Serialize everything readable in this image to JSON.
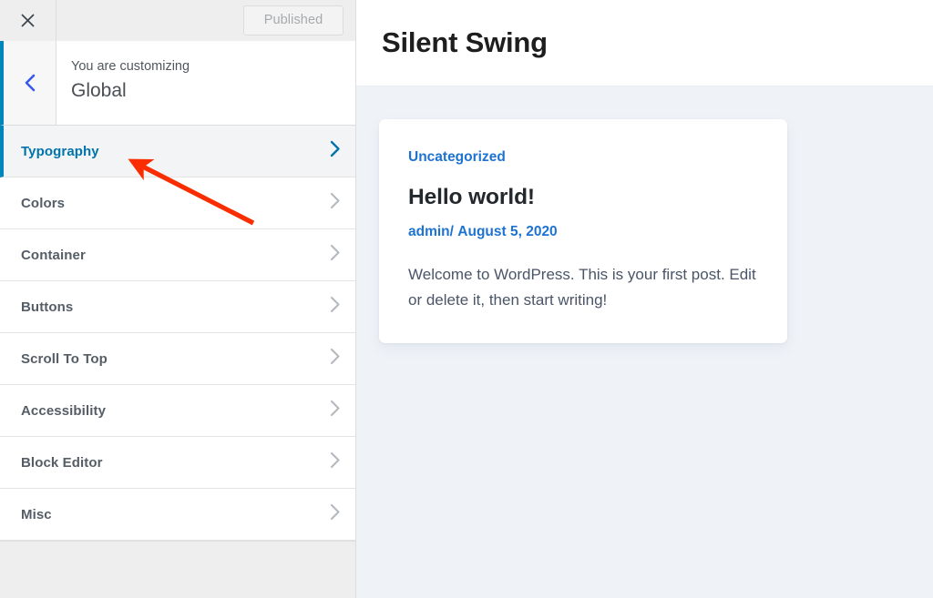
{
  "customizer": {
    "topbar": {
      "close_icon": "close-x-icon",
      "publish_label": "Published"
    },
    "panel": {
      "back_icon": "chevron-left-icon",
      "customizing_label": "You are customizing",
      "title": "Global"
    },
    "sections": [
      {
        "label": "Typography",
        "icon": "chevron-right-icon",
        "active": true
      },
      {
        "label": "Colors",
        "icon": "chevron-right-icon",
        "active": false
      },
      {
        "label": "Container",
        "icon": "chevron-right-icon",
        "active": false
      },
      {
        "label": "Buttons",
        "icon": "chevron-right-icon",
        "active": false
      },
      {
        "label": "Scroll To Top",
        "icon": "chevron-right-icon",
        "active": false
      },
      {
        "label": "Accessibility",
        "icon": "chevron-right-icon",
        "active": false
      },
      {
        "label": "Block Editor",
        "icon": "chevron-right-icon",
        "active": false
      },
      {
        "label": "Misc",
        "icon": "chevron-right-icon",
        "active": false
      }
    ]
  },
  "preview": {
    "site_title": "Silent Swing",
    "post": {
      "category": "Uncategorized",
      "title": "Hello world!",
      "author": "admin",
      "meta_separator": "/",
      "date": "August 5, 2020",
      "excerpt": "Welcome to WordPress. This is your first post. Edit or delete it, then start writing!"
    }
  },
  "annotation": {
    "type": "arrow",
    "color": "#f92d00",
    "points_to": "Typography"
  },
  "colors": {
    "accent_blue": "#0085ba",
    "link_blue": "#0073aa",
    "preview_link_blue": "#1e73d2",
    "chrome_gray": "#eeeeee",
    "preview_bg": "#eff3f8",
    "text_dark": "#555d66"
  }
}
